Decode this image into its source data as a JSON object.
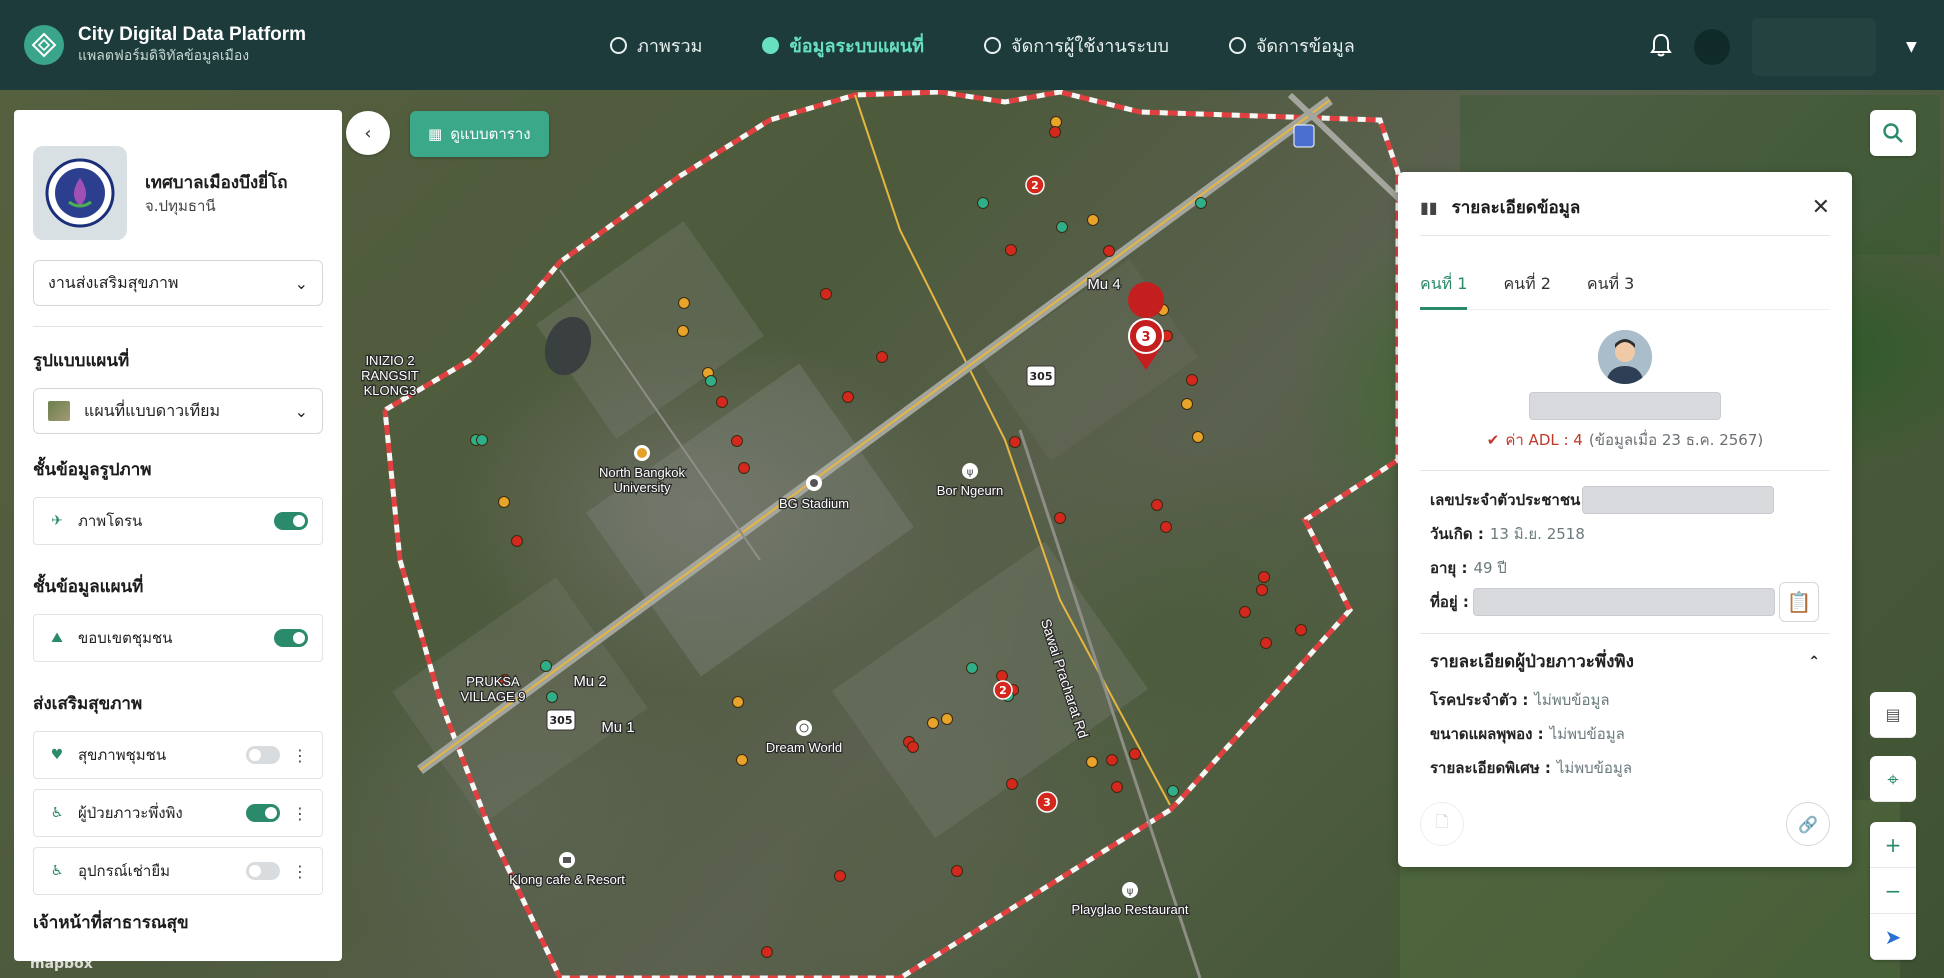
{
  "header": {
    "title": "City Digital Data Platform",
    "subtitle": "แพลตฟอร์มดิจิทัลข้อมูลเมือง",
    "nav": [
      {
        "label": "ภาพรวม",
        "active": false
      },
      {
        "label": "ข้อมูลระบบแผนที่",
        "active": true
      },
      {
        "label": "จัดการผู้ใช้งานระบบ",
        "active": false
      },
      {
        "label": "จัดการข้อมูล",
        "active": false
      }
    ]
  },
  "left": {
    "org_name": "เทศบาลเมืองบึงยี่โถ",
    "org_province": "จ.ปทุมธานี",
    "category_select": "งานส่งเสริมสุขภาพ",
    "map_style_title": "รูปแบบแผนที่",
    "map_style_value": "แผนที่แบบดาวเทียม",
    "image_layer_title": "ชั้นข้อมูลรูปภาพ",
    "drone_label": "ภาพโดรน",
    "map_layer_title": "ชั้นข้อมูลแผนที่",
    "boundary_label": "ขอบเขตชุมชน",
    "health_title": "ส่งเสริมสุขภาพ",
    "health_items": [
      {
        "label": "สุขภาพชุมชน",
        "on": false
      },
      {
        "label": "ผู้ป่วยภาวะพึ่งพิง",
        "on": true
      },
      {
        "label": "อุปกรณ์เช่ายืม",
        "on": false
      }
    ],
    "staff_title": "เจ้าหน้าที่สาธารณสุข"
  },
  "table_view_label": "ดูแบบตาราง",
  "map_labels": {
    "north_bangkok": "North Bangkok\nUniversity",
    "bg_stadium": "BG Stadium",
    "bor_ngeurn": "Bor Ngeurn",
    "dream_world": "Dream World",
    "klong_cafe": "Klong cafe & Resort",
    "playglao": "Playglao Restaurant",
    "mu4": "Mu 4",
    "mu2": "Mu 2",
    "mu1": "Mu 1",
    "inizio": "INIZIO 2\nRANGSIT\nKLONG3",
    "pruksa": "PRUKSA\nVILLAGE 9",
    "sawai_road": "Sawai Pracharat Rd",
    "route": "305",
    "mapbox": "mapbox"
  },
  "detail": {
    "title": "รายละเอียดข้อมูล",
    "tabs": [
      "คนที่ 1",
      "คนที่ 2",
      "คนที่ 3"
    ],
    "adl_label": "ค่า ADL : 4",
    "adl_date": "(ข้อมูลเมื่อ 23 ธ.ค. 2567)",
    "id_label": "เลขประจำตัวประชาชน",
    "dob_label": "วันเกิด :",
    "dob_value": "13 มิ.ย. 2518",
    "age_label": "อายุ :",
    "age_value": "49 ปี",
    "address_label": "ที่อยู่ :",
    "section_title": "รายละเอียดผู้ป่วยภาวะพึ่งพิง",
    "disease_label": "โรคประจำตัว :",
    "disease_value": "ไม่พบข้อมูล",
    "wound_label": "ขนาดแผลพุพอง :",
    "wound_value": "ไม่พบข้อมูล",
    "special_label": "รายละเอียดพิเศษ :",
    "special_value": "ไม่พบข้อมูล"
  },
  "colors": {
    "header_bg": "#1c3b3a",
    "accent": "#2b8a6c",
    "nav_active": "#66e0bf",
    "boundary": "#e04040",
    "marker_red": "#d4281f",
    "marker_orange": "#e8a32a",
    "marker_teal": "#2fae8a"
  },
  "map_markers": {
    "cluster_counts": [
      "3",
      "2",
      "2",
      "3"
    ]
  }
}
